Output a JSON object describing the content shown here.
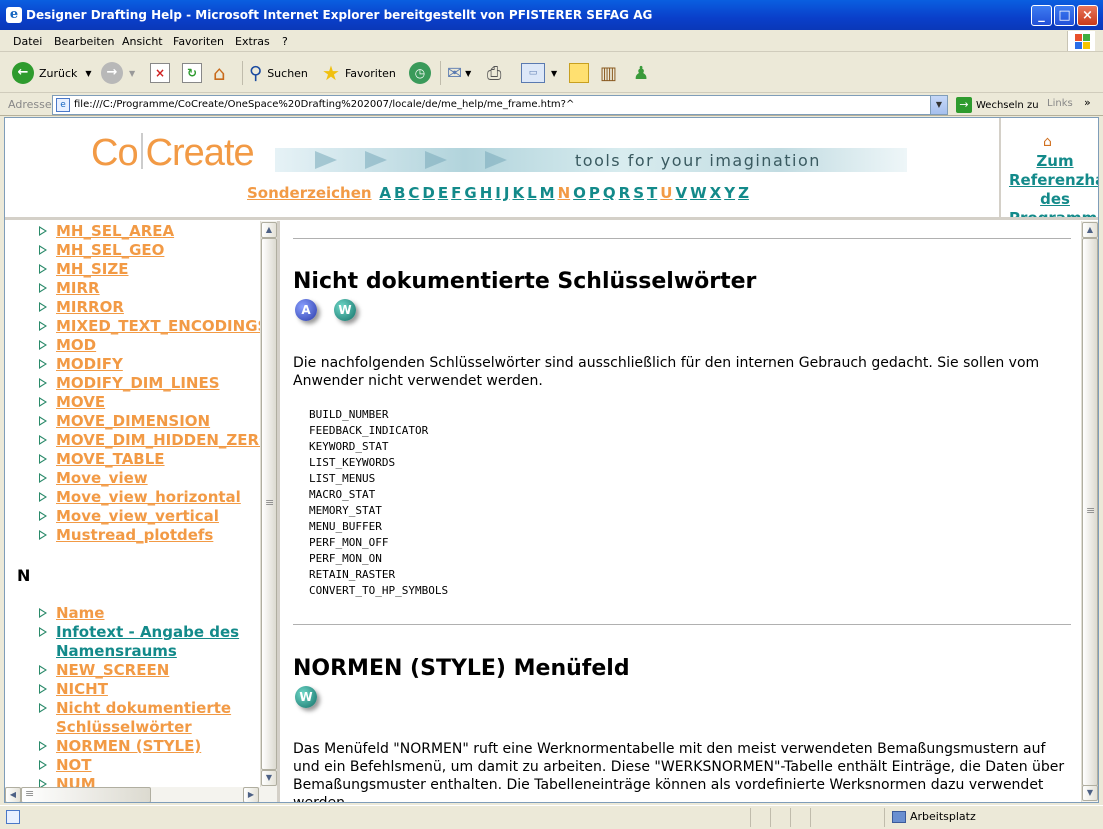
{
  "window": {
    "title": "Designer Drafting Help - Microsoft Internet Explorer bereitgestellt von PFISTERER SEFAG AG",
    "controls": [
      "_",
      "□",
      "×"
    ]
  },
  "menu": [
    "Datei",
    "Bearbeiten",
    "Ansicht",
    "Favoriten",
    "Extras",
    "?"
  ],
  "toolbar": {
    "back_label": "Zurück",
    "search_label": "Suchen",
    "favorites_label": "Favoriten"
  },
  "address": {
    "label": "Adresse",
    "url": "file:///C:/Programme/CoCreate/OneSpace%20Drafting%202007/locale/de/me_help/me_frame.htm?^",
    "go_label": "Wechseln zu",
    "links_label": "Links"
  },
  "header": {
    "logo_left": "Co",
    "logo_right": "Create",
    "tagline": "tools for your imagination",
    "special_chars": "Sonderzeichen",
    "letters": [
      "A",
      "B",
      "C",
      "D",
      "E",
      "F",
      "G",
      "H",
      "I",
      "J",
      "K",
      "L",
      "M",
      "N",
      "O",
      "P",
      "Q",
      "R",
      "S",
      "T",
      "U",
      "V",
      "W",
      "X",
      "Y",
      "Z"
    ],
    "active_letters": [
      "N",
      "U"
    ],
    "reference_link": "Zum Referenzhandbuch des Programms"
  },
  "sidebar": {
    "items_m": [
      {
        "label": "MH_SEL_AREA"
      },
      {
        "label": "MH_SEL_GEO"
      },
      {
        "label": "MH_SIZE"
      },
      {
        "label": "MIRR"
      },
      {
        "label": "MIRROR"
      },
      {
        "label": "MIXED_TEXT_ENCODINGS"
      },
      {
        "label": "MOD"
      },
      {
        "label": "MODIFY"
      },
      {
        "label": "MODIFY_DIM_LINES"
      },
      {
        "label": "MOVE"
      },
      {
        "label": "MOVE_DIMENSION"
      },
      {
        "label": "MOVE_DIM_HIDDEN_ZERO"
      },
      {
        "label": "MOVE_TABLE"
      },
      {
        "label": "Move_view"
      },
      {
        "label": "Move_view_horizontal"
      },
      {
        "label": "Move_view_vertical"
      },
      {
        "label": "Mustread_plotdefs"
      }
    ],
    "letter_n": "N",
    "items_n": [
      {
        "label": "Name"
      },
      {
        "label": "Infotext - Angabe des Namensraums"
      },
      {
        "label": "NEW_SCREEN"
      },
      {
        "label": "NICHT"
      },
      {
        "label": "Nicht dokumentierte Schlüsselwörter"
      },
      {
        "label": "NORMEN (STYLE)"
      },
      {
        "label": "NOT"
      },
      {
        "label": "NUM"
      }
    ],
    "link_colors": {
      "unvisited": "#f29a45",
      "visited": "#138a8a"
    }
  },
  "main": {
    "section1_title": "Nicht dokumentierte Schlüsselwörter",
    "section1_badges": [
      "A",
      "W"
    ],
    "section1_text": "Die nachfolgenden Schlüsselwörter sind ausschließlich für den internen Gebrauch gedacht. Sie sollen vom Anwender nicht verwendet werden.",
    "keywords": [
      "BUILD_NUMBER",
      "FEEDBACK_INDICATOR",
      "KEYWORD_STAT",
      "LIST_KEYWORDS",
      "LIST_MENUS",
      "MACRO_STAT",
      "MEMORY_STAT",
      "MENU_BUFFER",
      "PERF_MON_OFF",
      "PERF_MON_ON",
      "RETAIN_RASTER",
      "CONVERT_TO_HP_SYMBOLS"
    ],
    "section2_title": "NORMEN (STYLE) Menüfeld",
    "section2_badges": [
      "W"
    ],
    "section2_text": "Das Menüfeld \"NORMEN\" ruft eine Werknormentabelle mit den meist verwendeten Bemaßungsmustern auf und ein Befehlsmenü, um damit zu arbeiten. Diese \"WERKSNORMEN\"-Tabelle enthält Einträge, die Daten über Bemaßungsmuster enthalten. Die Tabelleneinträge können als vordefinierte Werksnormen dazu verwendet werden, ..."
  },
  "status": {
    "zone": "Arbeitsplatz"
  }
}
